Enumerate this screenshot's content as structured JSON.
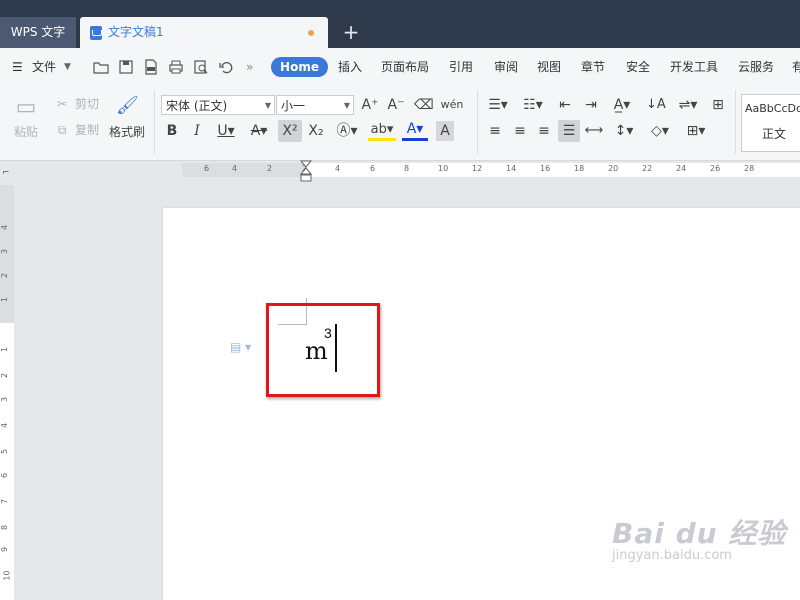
{
  "titlebar": {
    "app_tab": "WPS 文字",
    "doc_tab": "文字文稿1",
    "new_tab": "+"
  },
  "menubar": {
    "file": "文件",
    "items": [
      "Home",
      "插入",
      "页面布局",
      "引用",
      "审阅",
      "视图",
      "章节",
      "安全",
      "开发工具",
      "云服务",
      "有"
    ]
  },
  "ribbon": {
    "paste": "粘贴",
    "cut": "剪切",
    "copy": "复制",
    "format_painter": "格式刷",
    "font_name": "宋体 (正文)",
    "font_size": "小一",
    "style_preview": "AaBbCcDd",
    "style_name": "正文"
  },
  "ruler": {
    "h_ticks": [
      "6",
      "4",
      "2",
      "2",
      "4",
      "6",
      "8",
      "10",
      "12",
      "14",
      "16",
      "18",
      "20",
      "22",
      "24",
      "26",
      "28"
    ],
    "v_ticks": [
      "4",
      "3",
      "2",
      "1",
      "1",
      "2",
      "3",
      "4",
      "5",
      "6",
      "7",
      "8",
      "9",
      "10"
    ]
  },
  "document": {
    "text": "m",
    "superscript": "3"
  },
  "watermark": {
    "brand": "Bai du 经验",
    "url": "jingyan.baidu.com"
  },
  "colors": {
    "accent": "#3a79d6",
    "highlight": "#e0161b",
    "titlebar": "#2e3a4c"
  }
}
